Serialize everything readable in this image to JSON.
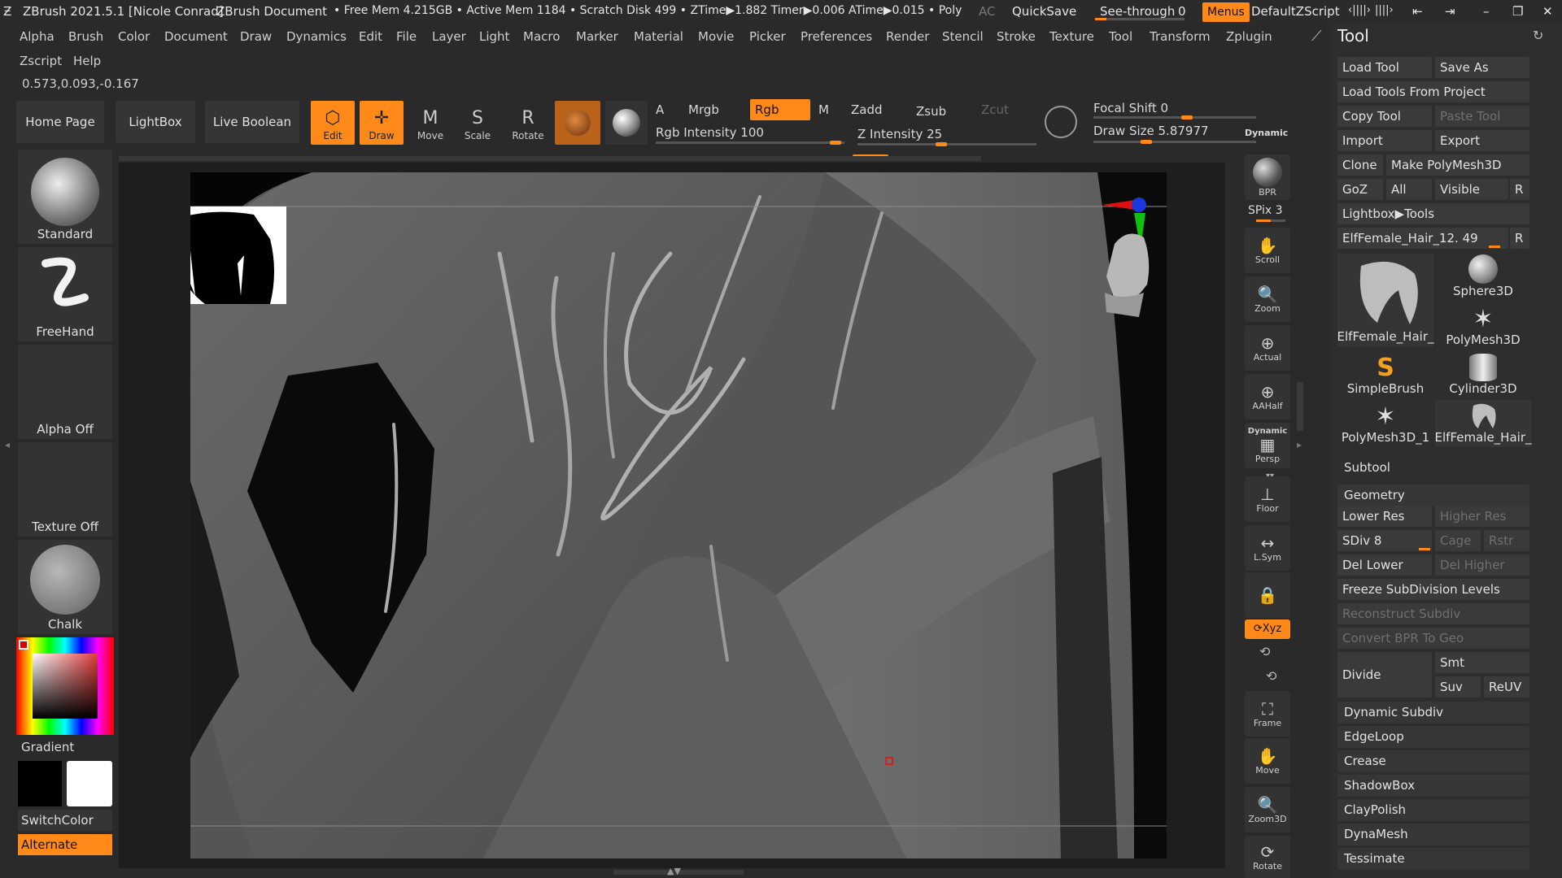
{
  "titlebar": {
    "app": "ZBrush 2021.5.1 [Nicole Conrad]",
    "doc": "ZBrush Document",
    "stats": "• Free Mem 4.215GB • Active Mem 1184 • Scratch Disk 499 • ZTime▶1.882 Timer▶0.006 ATime▶0.015 • Poly",
    "ac": "AC",
    "quicksave": "QuickSave",
    "seethrough": "See-through",
    "seethrough_val": "0",
    "menus": "Menus",
    "script": "DefaultZScript"
  },
  "menubar": [
    "Alpha",
    "Brush",
    "Color",
    "Document",
    "Draw",
    "Dynamics",
    "Edit",
    "File",
    "Layer",
    "Light",
    "Macro",
    "Marker",
    "Material",
    "Movie",
    "Picker",
    "Preferences",
    "Render",
    "Stencil",
    "Stroke",
    "Texture",
    "Tool",
    "Transform",
    "Zplugin"
  ],
  "menubar2": [
    "Zscript",
    "Help"
  ],
  "coords": "0.573,0.093,-0.167",
  "shelf": {
    "home": "Home Page",
    "lightbox": "LightBox",
    "liveboolean": "Live Boolean",
    "edit": "Edit",
    "draw": "Draw",
    "move": "Move",
    "scale": "Scale",
    "rotate": "Rotate",
    "a": "A",
    "mrgb": "Mrgb",
    "rgb": "Rgb",
    "m": "M",
    "zadd": "Zadd",
    "zsub": "Zsub",
    "zcut": "Zcut",
    "rgb_intensity": "Rgb Intensity 100",
    "z_intensity": "Z Intensity 25",
    "focal_shift": "Focal Shift 0",
    "draw_size": "Draw Size 5.87977",
    "dynamic": "Dynamic"
  },
  "leftshelf": {
    "standard": "Standard",
    "freehand": "FreeHand",
    "alpha_off": "Alpha Off",
    "texture_off": "Texture Off",
    "chalk": "Chalk",
    "gradient": "Gradient",
    "switchcolor": "SwitchColor",
    "alternate": "Alternate"
  },
  "dock": [
    "BPR",
    "SPix 3",
    "Scroll",
    "Zoom",
    "Actual",
    "AAHalf",
    "Persp",
    "Floor",
    "L.Sym",
    "",
    "Xyz",
    "",
    "",
    "Frame",
    "Move",
    "Zoom3D",
    "Rotate"
  ],
  "dock_labels": {
    "bpr": "BPR",
    "spix": "SPix 3",
    "scroll": "Scroll",
    "zoom": "Zoom",
    "actual": "Actual",
    "aahalf": "AAHalf",
    "dynamic": "Dynamic",
    "persp": "Persp",
    "floor": "Floor",
    "lsym": "L.Sym",
    "xyz": "Xyz",
    "frame": "Frame",
    "move": "Move",
    "zoom3d": "Zoom3D",
    "rotate": "Rotate"
  },
  "tool": {
    "title": "Tool",
    "load_tool": "Load Tool",
    "save_as": "Save As",
    "load_from_project": "Load Tools From Project",
    "copy_tool": "Copy Tool",
    "paste_tool": "Paste Tool",
    "import": "Import",
    "export": "Export",
    "clone": "Clone",
    "make_polymesh": "Make PolyMesh3D",
    "goz": "GoZ",
    "all": "All",
    "visible": "Visible",
    "r": "R",
    "lightbox_tools": "Lightbox▶Tools",
    "current_tool": "ElfFemale_Hair_12. 49",
    "tiles": [
      "ElfFemale_Hair_",
      "Sphere3D",
      "PolyMesh3D",
      "SimpleBrush",
      "Cylinder3D",
      "PolyMesh3D_1",
      "ElfFemale_Hair_"
    ],
    "subtool": "Subtool",
    "geometry": "Geometry",
    "lower_res": "Lower Res",
    "higher_res": "Higher Res",
    "sdiv": "SDiv 8",
    "cage": "Cage",
    "rstr": "Rstr",
    "del_lower": "Del Lower",
    "del_higher": "Del Higher",
    "freeze": "Freeze SubDivision Levels",
    "reconstruct": "Reconstruct Subdiv",
    "convert_bpr": "Convert BPR To Geo",
    "divide": "Divide",
    "smt": "Smt",
    "suv": "Suv",
    "reuv": "ReUV",
    "dynamic_subdiv": "Dynamic Subdiv",
    "edgeloop": "EdgeLoop",
    "crease": "Crease",
    "shadowbox": "ShadowBox",
    "claypolish": "ClayPolish",
    "dynamesh": "DynaMesh",
    "tessimate": "Tessimate"
  }
}
